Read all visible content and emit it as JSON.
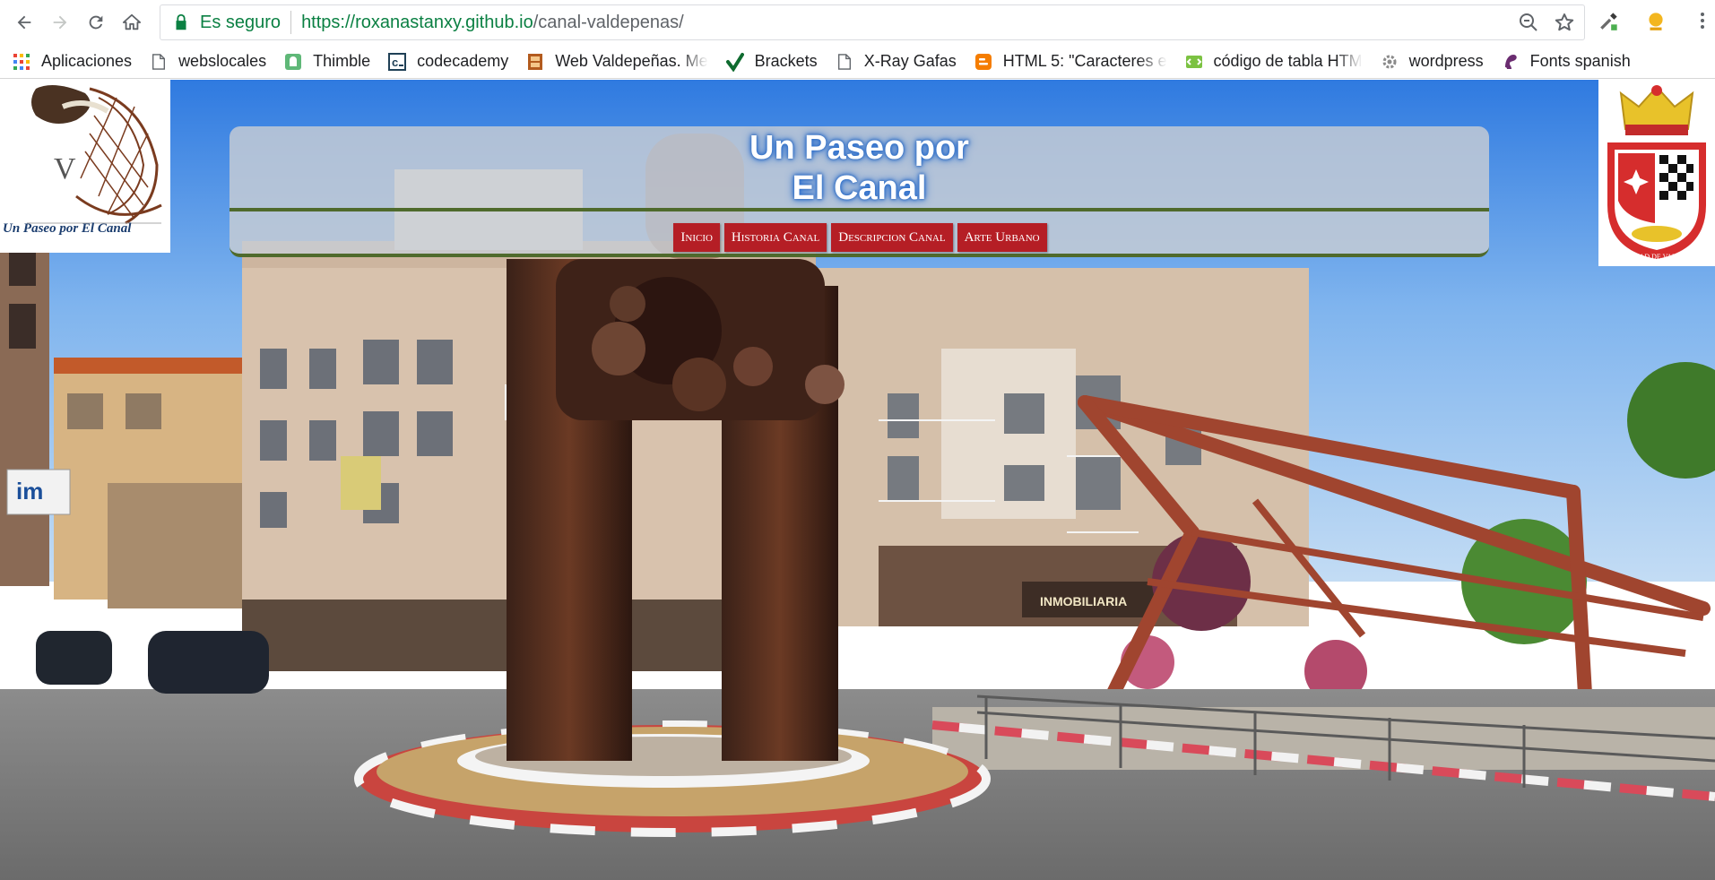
{
  "browser": {
    "security_label": "Es seguro",
    "url_main": "https://roxanastanxy.github.io",
    "url_path": "/canal-valdepenas/",
    "bookmarks": [
      {
        "label": "Aplicaciones",
        "icon": "apps-grid-icon"
      },
      {
        "label": "webslocales",
        "icon": "page-icon"
      },
      {
        "label": "Thimble",
        "icon": "thimble-icon"
      },
      {
        "label": "codecademy",
        "icon": "codecademy-icon"
      },
      {
        "label": "Web Valdepeñas. Me",
        "icon": "web-valdepenas-icon"
      },
      {
        "label": "Brackets",
        "icon": "brackets-checkmark-icon"
      },
      {
        "label": "X-Ray Gafas",
        "icon": "page-icon"
      },
      {
        "label": "HTML 5: \"Caracteres e",
        "icon": "blogger-icon"
      },
      {
        "label": "código de tabla HTM",
        "icon": "table-code-icon"
      },
      {
        "label": "wordpress",
        "icon": "gear-icon"
      },
      {
        "label": "Fonts spanish",
        "icon": "fonts-icon"
      }
    ]
  },
  "page": {
    "title_line1": "Un Paseo por",
    "title_line2": "El Canal",
    "logo_left_text": "Un Paseo por El Canal",
    "logo_left_letter": "V",
    "logo_right_text": "CIUDAD DE VALDEPEÑAS",
    "menu": [
      {
        "label": "Inicio"
      },
      {
        "label": "Historia Canal"
      },
      {
        "label": "Descripcion Canal"
      },
      {
        "label": "Arte Urbano"
      }
    ],
    "photo_sign_text": "INMOBILIARIA",
    "photo_sign_im": "im"
  },
  "colors": {
    "menu_bg": "#b51e25",
    "panel_border": "#4f6a2c",
    "secure_green": "#0b8043"
  }
}
